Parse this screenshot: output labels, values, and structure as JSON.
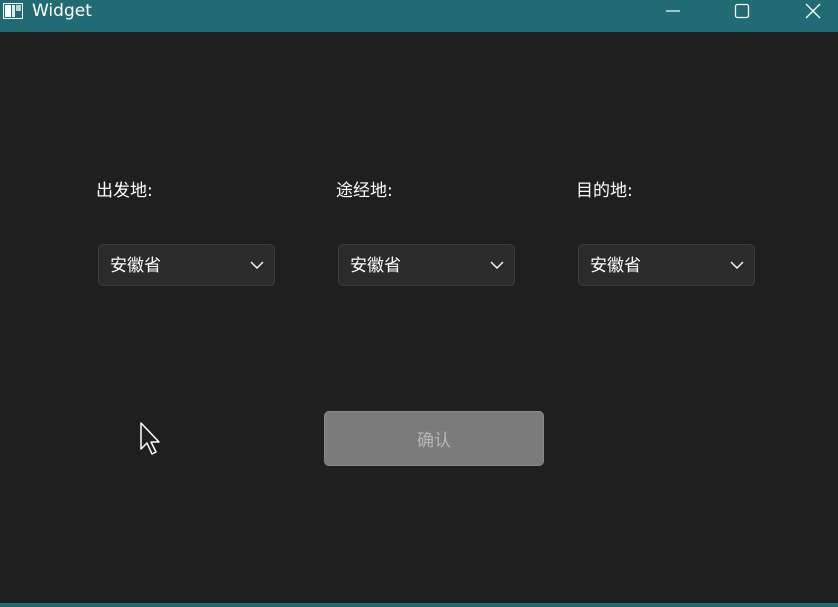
{
  "window": {
    "title": "Widget",
    "accent_color": "#216b74",
    "background_color": "#1f1f1f",
    "controls": {
      "minimize_icon": "minimize-icon",
      "maximize_icon": "maximize-icon",
      "close_icon": "close-icon"
    }
  },
  "form": {
    "departure": {
      "label": "出发地:",
      "selected": "安徽省"
    },
    "waypoint": {
      "label": "途经地:",
      "selected": "安徽省"
    },
    "destination": {
      "label": "目的地:",
      "selected": "安徽省"
    },
    "confirm_label": "确认",
    "confirm_enabled": false
  }
}
